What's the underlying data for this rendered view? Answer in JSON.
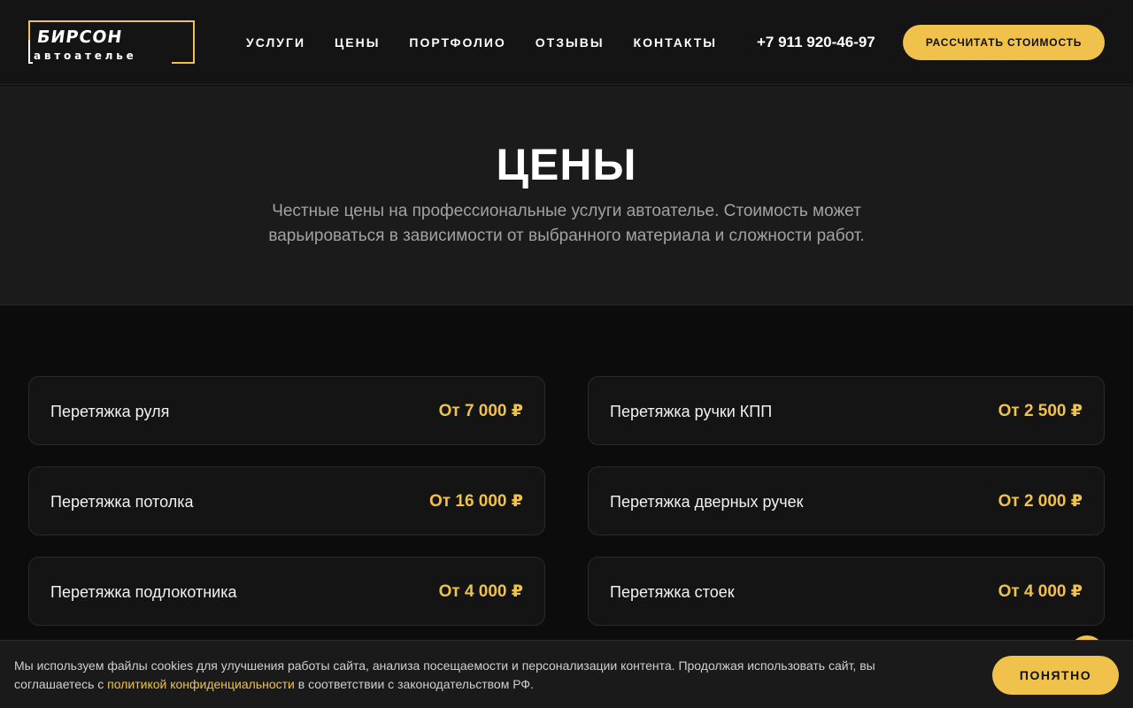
{
  "header": {
    "logo_main": "БИРСОН",
    "logo_sub": "автоателье",
    "nav": [
      {
        "label": "УСЛУГИ"
      },
      {
        "label": "ЦЕНЫ"
      },
      {
        "label": "ПОРТФОЛИО"
      },
      {
        "label": "ОТЗЫВЫ"
      },
      {
        "label": "КОНТАКТЫ"
      }
    ],
    "phone": "+7 911 920-46-97",
    "cta_label": "РАССЧИТАТЬ СТОИМОСТЬ",
    "accent_color": "#f0c24b"
  },
  "hero": {
    "title": "ЦЕНЫ",
    "subtitle": "Честные цены на профессиональные услуги автоателье. Стоимость может варьироваться в зависимости от выбранного материала и сложности работ."
  },
  "prices": [
    {
      "name": "Перетяжка руля",
      "price": "От 7 000 ₽"
    },
    {
      "name": "Перетяжка ручки КПП",
      "price": "От 2 500 ₽"
    },
    {
      "name": "Перетяжка потолка",
      "price": "От 16 000 ₽"
    },
    {
      "name": "Перетяжка дверных ручек",
      "price": "От 2 000 ₽"
    },
    {
      "name": "Перетяжка подлокотника",
      "price": "От 4 000 ₽"
    },
    {
      "name": "Перетяжка стоек",
      "price": "От 4 000 ₽"
    }
  ],
  "cookie": {
    "text_before": "Мы используем файлы cookies для улучшения работы сайта, анализа посещаемости и персонализации контента. Продолжая использовать сайт, вы соглашаетесь с ",
    "link_text": "политикой конфиденциальности",
    "text_after": " в соответствии с законодательством РФ.",
    "button_label": "ПОНЯТНО"
  }
}
